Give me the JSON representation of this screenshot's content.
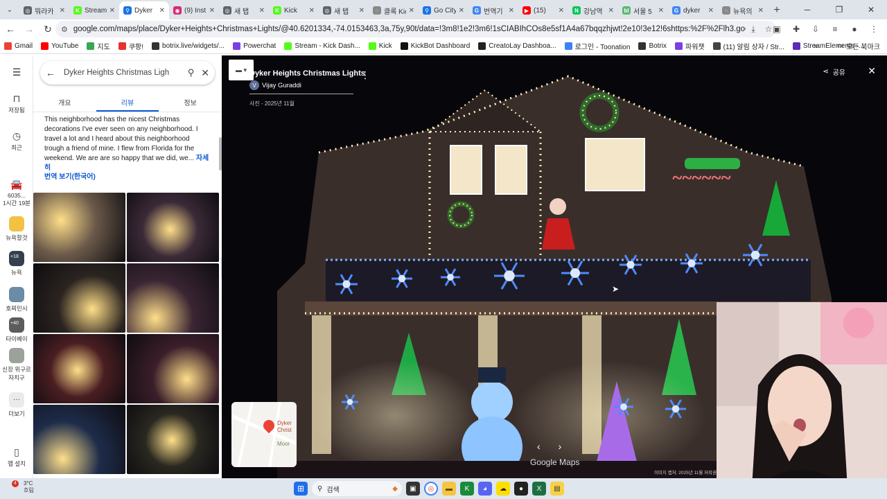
{
  "tabs": [
    {
      "label": "뭐라카",
      "fav": "#5f6368",
      "fav_glyph": "◎",
      "active": false
    },
    {
      "label": "Stream",
      "fav": "#53fc18",
      "fav_glyph": "K",
      "active": false
    },
    {
      "label": "Dyker",
      "fav": "#1a73e8",
      "fav_glyph": "⚲",
      "active": true
    },
    {
      "label": "(9) Inst",
      "fav": "#d62976",
      "fav_glyph": "◉",
      "active": false
    },
    {
      "label": "새 탭",
      "fav": "#5f6368",
      "fav_glyph": "◎",
      "active": false
    },
    {
      "label": "Kick",
      "fav": "#53fc18",
      "fav_glyph": "K",
      "active": false
    },
    {
      "label": "새 탭",
      "fav": "#5f6368",
      "fav_glyph": "◎",
      "active": false
    },
    {
      "label": "클록 Kic",
      "fav": "#888888",
      "fav_glyph": "◌",
      "active": false
    },
    {
      "label": "Go City",
      "fav": "#1a73e8",
      "fav_glyph": "⚲",
      "active": false
    },
    {
      "label": "번역기",
      "fav": "#4285f4",
      "fav_glyph": "G",
      "active": false
    },
    {
      "label": "(15)",
      "fav": "#ff0000",
      "fav_glyph": "▶",
      "active": false
    },
    {
      "label": "강남역",
      "fav": "#03c75a",
      "fav_glyph": "N",
      "active": false
    },
    {
      "label": "서울 5",
      "fav": "#5bb974",
      "fav_glyph": "bl",
      "active": false
    },
    {
      "label": "dyker",
      "fav": "#4285f4",
      "fav_glyph": "G",
      "active": false
    },
    {
      "label": "뉴욕의",
      "fav": "#888888",
      "fav_glyph": "◌",
      "active": false
    }
  ],
  "omnibox": {
    "url": "google.com/maps/place/Dyker+Heights+Christmas+Lights/@40.6201334,-74.0153463,3a,75y,90t/data=!3m8!1e2!3m6!1sCIABIhCOs8e5sf1A4a67bqqzhjwt!2e10!3e12!6shttps:%2F%2Flh3.googleusercontent.com%2Fgeougc-cs%2F..."
  },
  "bookmarks": [
    {
      "label": "Gmail",
      "color": "#ea4335"
    },
    {
      "label": "YouTube",
      "color": "#ff0000"
    },
    {
      "label": "지도",
      "color": "#34a853"
    },
    {
      "label": "쿠팡!",
      "color": "#e3342f"
    },
    {
      "label": "botrix.live/widgets/...",
      "color": "#333333"
    },
    {
      "label": "Powerchat",
      "color": "#7b3fe4"
    },
    {
      "label": "Stream - Kick Dash...",
      "color": "#53fc18"
    },
    {
      "label": "Kick",
      "color": "#53fc18"
    },
    {
      "label": "KickBot Dashboard",
      "color": "#111111"
    },
    {
      "label": "CreatoLay Dashboa...",
      "color": "#222222"
    },
    {
      "label": "로그인 - Toonation",
      "color": "#3b82f6"
    },
    {
      "label": "Botrix",
      "color": "#333333"
    },
    {
      "label": "파워챗",
      "color": "#7b3fe4"
    },
    {
      "label": "(11) 알림 상자 / Str...",
      "color": "#444444"
    },
    {
      "label": "StreamElements -...",
      "color": "#5a2db5"
    }
  ],
  "bookmarks_all": "모든 북마크",
  "rail": {
    "menu": "☰",
    "saved": "저장됨",
    "recent": "최근",
    "trip": "6035...\n1시간 19분",
    "items": [
      {
        "label": "뉴욕할것",
        "color": "#f3c243"
      },
      {
        "label": "뉴욕",
        "color": "#33404f",
        "badge": "+18"
      },
      {
        "label": "호찌민시",
        "color": "#6a8ca6"
      },
      {
        "label": "타이베이",
        "color": "#5c5c5c",
        "badge": "+40"
      },
      {
        "label": "신장 위구르 자치구",
        "color": "#9aa29a"
      }
    ],
    "more": "더보기",
    "install": "앱 설치"
  },
  "search": {
    "query": "Dyker Heights Christmas Ligh"
  },
  "panel_tabs": [
    "개요",
    "리뷰",
    "정보"
  ],
  "review": {
    "text": "This neighborhood has the nicest Christmas decorations I've ever seen on any neighborhood. I travel a lot and I heard about this neighborhood trough a friend of mine. I flew from Florida for the weekend. We are are so happy that we did, we... ",
    "more": "자세히",
    "translate": "번역 보기(한국어)"
  },
  "photos": [
    "#6b5a4a",
    "#3b2a38",
    "#2b2420",
    "#3a2533",
    "#4a1e22",
    "#3b1e2a",
    "#1e2c4a",
    "#2a2820"
  ],
  "viewer": {
    "title": "Dyker Heights Christmas Lights",
    "author": "Vijay Guraddi",
    "author_initial": "V",
    "date": "사진 - 2025년 11월",
    "share": "공유",
    "minimap_label": "Dyker\nChrist",
    "minimap_label2": "Moor",
    "logo": "Google Maps",
    "footer": "이미지 캡처: 2025년 11월     저작권"
  },
  "taskbar": {
    "weather_temp": "3°C",
    "weather_desc": "흐림",
    "badge": "4",
    "search": "검색"
  }
}
